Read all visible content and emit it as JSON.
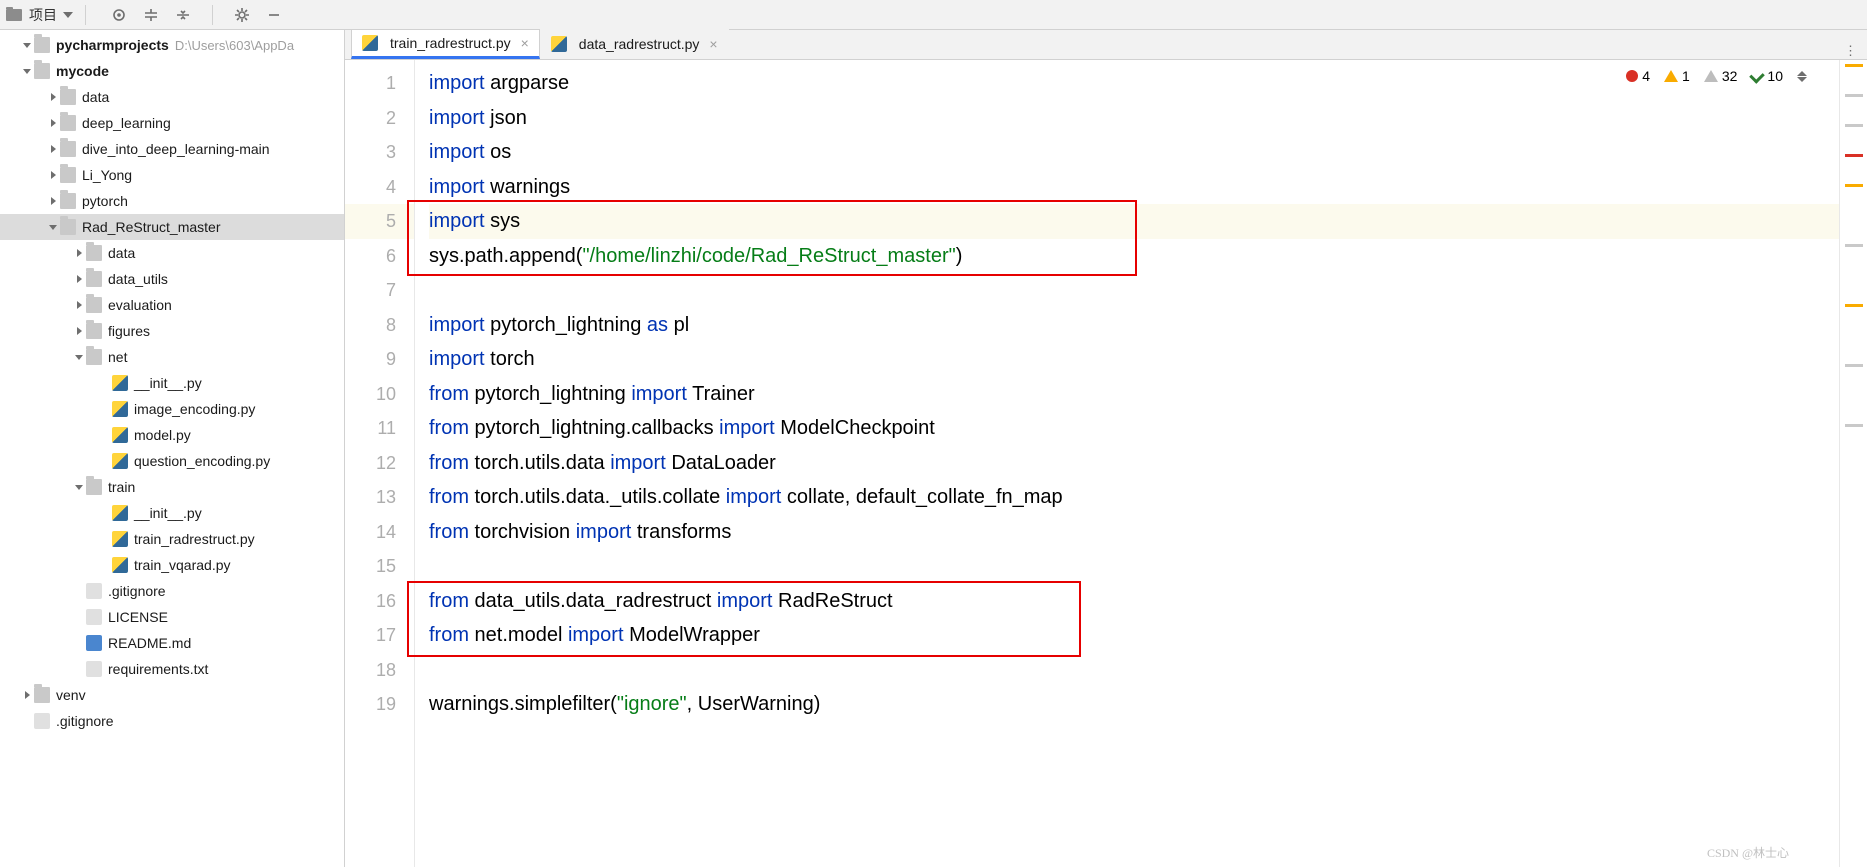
{
  "toolbar": {
    "project_label": "项目"
  },
  "project": {
    "root": "pycharmprojects",
    "path": "D:\\Users\\603\\AppDa",
    "nodes": [
      {
        "d": 0,
        "e": true,
        "i": "dir",
        "n": "mycode",
        "b": true
      },
      {
        "d": 1,
        "e": null,
        "i": "dir",
        "n": "data"
      },
      {
        "d": 1,
        "e": null,
        "i": "dir",
        "n": "deep_learning"
      },
      {
        "d": 1,
        "e": null,
        "i": "dir",
        "n": "dive_into_deep_learning-main"
      },
      {
        "d": 1,
        "e": null,
        "i": "dir",
        "n": "Li_Yong"
      },
      {
        "d": 1,
        "e": null,
        "i": "dir",
        "n": "pytorch"
      },
      {
        "d": 1,
        "e": true,
        "i": "dir",
        "n": "Rad_ReStruct_master",
        "sel": true
      },
      {
        "d": 2,
        "e": null,
        "i": "dir",
        "n": "data"
      },
      {
        "d": 2,
        "e": null,
        "i": "dir",
        "n": "data_utils"
      },
      {
        "d": 2,
        "e": null,
        "i": "dir",
        "n": "evaluation"
      },
      {
        "d": 2,
        "e": null,
        "i": "dir",
        "n": "figures"
      },
      {
        "d": 2,
        "e": true,
        "i": "dir",
        "n": "net"
      },
      {
        "d": 3,
        "e": false,
        "i": "py",
        "n": "__init__.py"
      },
      {
        "d": 3,
        "e": false,
        "i": "py",
        "n": "image_encoding.py"
      },
      {
        "d": 3,
        "e": false,
        "i": "py",
        "n": "model.py"
      },
      {
        "d": 3,
        "e": false,
        "i": "py",
        "n": "question_encoding.py"
      },
      {
        "d": 2,
        "e": true,
        "i": "dir",
        "n": "train"
      },
      {
        "d": 3,
        "e": false,
        "i": "py",
        "n": "__init__.py"
      },
      {
        "d": 3,
        "e": false,
        "i": "py",
        "n": "train_radrestruct.py"
      },
      {
        "d": 3,
        "e": false,
        "i": "py",
        "n": "train_vqarad.py"
      },
      {
        "d": 2,
        "e": false,
        "i": "txt",
        "n": ".gitignore"
      },
      {
        "d": 2,
        "e": false,
        "i": "txt",
        "n": "LICENSE"
      },
      {
        "d": 2,
        "e": false,
        "i": "md",
        "n": "README.md"
      },
      {
        "d": 2,
        "e": false,
        "i": "txt",
        "n": "requirements.txt"
      },
      {
        "d": 0,
        "e": null,
        "i": "dir",
        "n": "venv"
      },
      {
        "d": 0,
        "e": false,
        "i": "txt",
        "n": ".gitignore"
      }
    ]
  },
  "tabs": [
    {
      "label": "train_radrestruct.py",
      "active": true
    },
    {
      "label": "data_radrestruct.py",
      "active": false
    }
  ],
  "analysis": {
    "errors": "4",
    "warnings": "1",
    "weak_warnings": "32",
    "ok": "10"
  },
  "code": {
    "lines": [
      {
        "n": 1,
        "h": "<span class='kw'>import</span> argparse"
      },
      {
        "n": 2,
        "h": "<span class='kw'>import</span> json"
      },
      {
        "n": 3,
        "h": "<span class='kw'>import</span> os"
      },
      {
        "n": 4,
        "h": "<span class='kw'>import</span> warnings"
      },
      {
        "n": 5,
        "h": "<span class='kw'>import</span> sys",
        "cur": true
      },
      {
        "n": 6,
        "h": "sys.path.append(<span class='str'>\"/home/linzhi/code/Rad_ReStruct_master\"</span>)"
      },
      {
        "n": 7,
        "h": ""
      },
      {
        "n": 8,
        "h": "<span class='kw'>import</span> pytorch_lightning <span class='kw'>as</span> pl"
      },
      {
        "n": 9,
        "h": "<span class='kw'>import</span> torch"
      },
      {
        "n": 10,
        "h": "<span class='kw'>from</span> pytorch_lightning <span class='kw'>import</span> Trainer"
      },
      {
        "n": 11,
        "h": "<span class='kw'>from</span> pytorch_lightning.callbacks <span class='kw'>import</span> ModelCheckpoint"
      },
      {
        "n": 12,
        "h": "<span class='kw'>from</span> torch.utils.data <span class='kw'>import</span> DataLoader"
      },
      {
        "n": 13,
        "h": "<span class='kw'>from</span> torch.utils.data._utils.collate <span class='kw'>import</span> collate, default_collate_fn_map"
      },
      {
        "n": 14,
        "h": "<span class='kw'>from</span> torchvision <span class='kw'>import</span> transforms"
      },
      {
        "n": 15,
        "h": ""
      },
      {
        "n": 16,
        "h": "<span class='kw'>from</span> data_utils.data_radrestruct <span class='kw'>import</span> RadReStruct"
      },
      {
        "n": 17,
        "h": "<span class='kw'>from</span> net.model <span class='kw'>import</span> ModelWrapper"
      },
      {
        "n": 18,
        "h": ""
      },
      {
        "n": 19,
        "h": "warnings.simplefilter(<span class='str'>\"ignore\"</span>, UserWarning)"
      }
    ]
  },
  "watermark": "CSDN @林士心"
}
